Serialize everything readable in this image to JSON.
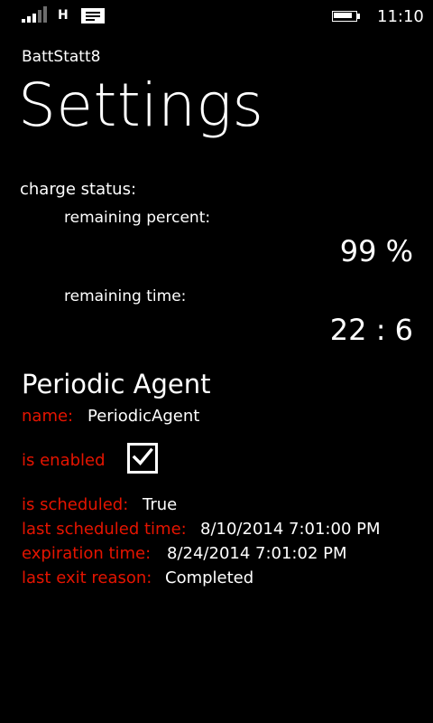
{
  "status_bar": {
    "network_type": "H",
    "time": "11:10",
    "signal_icon": "signal-strength-icon",
    "message_icon": "message-icon",
    "battery_icon": "battery-icon",
    "battery_level": 0.9
  },
  "app": {
    "title": "BattStatt8"
  },
  "page": {
    "title": "Settings"
  },
  "charge": {
    "label": "charge status:",
    "percent_label": "remaining percent:",
    "percent_value": "99 %",
    "time_label": "remaining time:",
    "time_value": "22 : 6"
  },
  "agent": {
    "title": "Periodic Agent",
    "name_label": "name:",
    "name_value": "PeriodicAgent",
    "enabled_label": "is enabled",
    "enabled_checked": true,
    "scheduled_label": "is scheduled:",
    "scheduled_value": "True",
    "last_scheduled_label": "last scheduled time:",
    "last_scheduled_value": "8/10/2014 7:01:00 PM",
    "expiration_label": "expiration time:",
    "expiration_value": "8/24/2014 7:01:02 PM",
    "exit_reason_label": "last exit reason:",
    "exit_reason_value": "Completed"
  },
  "colors": {
    "background": "#000000",
    "foreground": "#ffffff",
    "accent_label": "#e51400",
    "signal_dim": "#6d6d6d"
  }
}
